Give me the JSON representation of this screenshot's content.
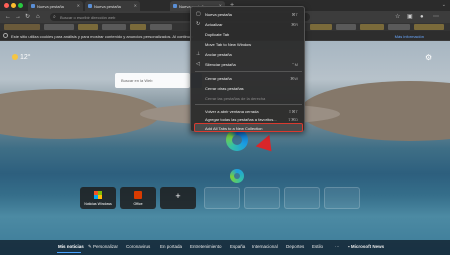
{
  "tabs": [
    {
      "title": "Nueva pestaña"
    },
    {
      "title": "Nueva pestaña"
    },
    {
      "title": "Nueva pestaña"
    }
  ],
  "toolbar": {
    "address_placeholder": "Buscar o escribir dirección web"
  },
  "infobar": {
    "text": "Este sitio utiliza cookies para análisis y para mostrar contenido y anuncios personalizados. Al continuar",
    "link": "Más información"
  },
  "weather": {
    "temp": "12°"
  },
  "search": {
    "placeholder": "Buscar en la Web"
  },
  "tiles": [
    {
      "label": "Noticias Windows"
    },
    {
      "label": "Office"
    }
  ],
  "context_menu": {
    "items": [
      {
        "icon": "tab-icon",
        "label": "Nueva pestaña",
        "shortcut": "⌘T",
        "state": "normal"
      },
      {
        "icon": "refresh-icon",
        "label": "Actualizar",
        "shortcut": "⌘R",
        "state": "normal"
      },
      {
        "icon": "",
        "label": "Duplicate Tab",
        "shortcut": "",
        "state": "normal"
      },
      {
        "icon": "",
        "label": "Move Tab to New Window",
        "shortcut": "",
        "state": "normal"
      },
      {
        "icon": "pin-icon",
        "label": "Anclar pestaña",
        "shortcut": "",
        "state": "normal"
      },
      {
        "icon": "mute-icon",
        "label": "Silenciar pestaña",
        "shortcut": "⌃M",
        "state": "normal"
      },
      {
        "icon": "",
        "label": "Cerrar pestaña",
        "shortcut": "⌘W",
        "state": "normal"
      },
      {
        "icon": "",
        "label": "Cerrar otras pestañas",
        "shortcut": "",
        "state": "normal"
      },
      {
        "icon": "",
        "label": "Cerrar las pestañas de la derecha",
        "shortcut": "",
        "state": "disabled"
      },
      {
        "icon": "",
        "label": "Volver a abrir ventana cerrada",
        "shortcut": "⇧⌘T",
        "state": "normal"
      },
      {
        "icon": "",
        "label": "Agregar todas las pestañas a favoritos...",
        "shortcut": "⇧⌘D",
        "state": "normal"
      },
      {
        "icon": "",
        "label": "Add All Tabs to a New Collection",
        "shortcut": "",
        "state": "highlight"
      }
    ]
  },
  "news_nav": [
    "Mis noticias",
    "Personalizar",
    "Coronavirus",
    "En portada",
    "Entretenimiento",
    "España",
    "Internacional",
    "Deportes",
    "Estilo",
    "Microsoft News"
  ]
}
